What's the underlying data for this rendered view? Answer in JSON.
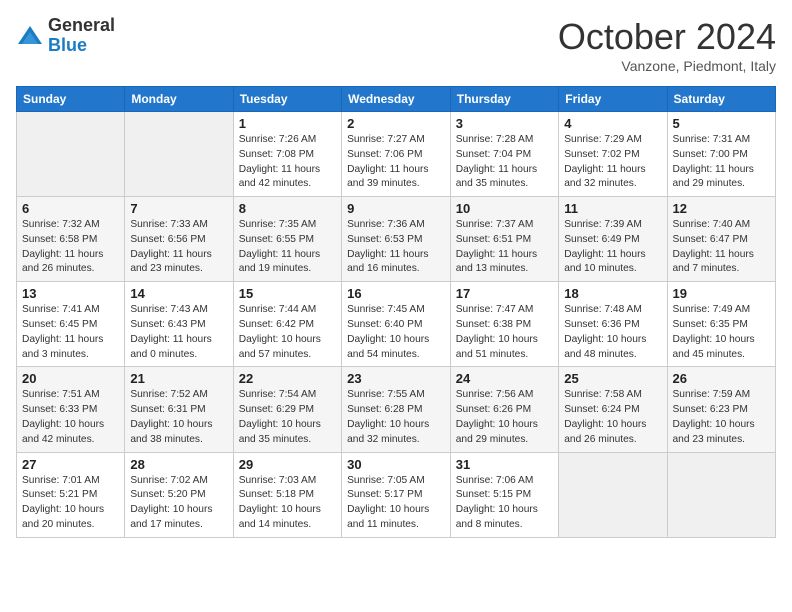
{
  "header": {
    "logo_line1": "General",
    "logo_line2": "Blue",
    "month": "October 2024",
    "location": "Vanzone, Piedmont, Italy"
  },
  "days_of_week": [
    "Sunday",
    "Monday",
    "Tuesday",
    "Wednesday",
    "Thursday",
    "Friday",
    "Saturday"
  ],
  "weeks": [
    [
      {
        "day": "",
        "info": ""
      },
      {
        "day": "",
        "info": ""
      },
      {
        "day": "1",
        "info": "Sunrise: 7:26 AM\nSunset: 7:08 PM\nDaylight: 11 hours and 42 minutes."
      },
      {
        "day": "2",
        "info": "Sunrise: 7:27 AM\nSunset: 7:06 PM\nDaylight: 11 hours and 39 minutes."
      },
      {
        "day": "3",
        "info": "Sunrise: 7:28 AM\nSunset: 7:04 PM\nDaylight: 11 hours and 35 minutes."
      },
      {
        "day": "4",
        "info": "Sunrise: 7:29 AM\nSunset: 7:02 PM\nDaylight: 11 hours and 32 minutes."
      },
      {
        "day": "5",
        "info": "Sunrise: 7:31 AM\nSunset: 7:00 PM\nDaylight: 11 hours and 29 minutes."
      }
    ],
    [
      {
        "day": "6",
        "info": "Sunrise: 7:32 AM\nSunset: 6:58 PM\nDaylight: 11 hours and 26 minutes."
      },
      {
        "day": "7",
        "info": "Sunrise: 7:33 AM\nSunset: 6:56 PM\nDaylight: 11 hours and 23 minutes."
      },
      {
        "day": "8",
        "info": "Sunrise: 7:35 AM\nSunset: 6:55 PM\nDaylight: 11 hours and 19 minutes."
      },
      {
        "day": "9",
        "info": "Sunrise: 7:36 AM\nSunset: 6:53 PM\nDaylight: 11 hours and 16 minutes."
      },
      {
        "day": "10",
        "info": "Sunrise: 7:37 AM\nSunset: 6:51 PM\nDaylight: 11 hours and 13 minutes."
      },
      {
        "day": "11",
        "info": "Sunrise: 7:39 AM\nSunset: 6:49 PM\nDaylight: 11 hours and 10 minutes."
      },
      {
        "day": "12",
        "info": "Sunrise: 7:40 AM\nSunset: 6:47 PM\nDaylight: 11 hours and 7 minutes."
      }
    ],
    [
      {
        "day": "13",
        "info": "Sunrise: 7:41 AM\nSunset: 6:45 PM\nDaylight: 11 hours and 3 minutes."
      },
      {
        "day": "14",
        "info": "Sunrise: 7:43 AM\nSunset: 6:43 PM\nDaylight: 11 hours and 0 minutes."
      },
      {
        "day": "15",
        "info": "Sunrise: 7:44 AM\nSunset: 6:42 PM\nDaylight: 10 hours and 57 minutes."
      },
      {
        "day": "16",
        "info": "Sunrise: 7:45 AM\nSunset: 6:40 PM\nDaylight: 10 hours and 54 minutes."
      },
      {
        "day": "17",
        "info": "Sunrise: 7:47 AM\nSunset: 6:38 PM\nDaylight: 10 hours and 51 minutes."
      },
      {
        "day": "18",
        "info": "Sunrise: 7:48 AM\nSunset: 6:36 PM\nDaylight: 10 hours and 48 minutes."
      },
      {
        "day": "19",
        "info": "Sunrise: 7:49 AM\nSunset: 6:35 PM\nDaylight: 10 hours and 45 minutes."
      }
    ],
    [
      {
        "day": "20",
        "info": "Sunrise: 7:51 AM\nSunset: 6:33 PM\nDaylight: 10 hours and 42 minutes."
      },
      {
        "day": "21",
        "info": "Sunrise: 7:52 AM\nSunset: 6:31 PM\nDaylight: 10 hours and 38 minutes."
      },
      {
        "day": "22",
        "info": "Sunrise: 7:54 AM\nSunset: 6:29 PM\nDaylight: 10 hours and 35 minutes."
      },
      {
        "day": "23",
        "info": "Sunrise: 7:55 AM\nSunset: 6:28 PM\nDaylight: 10 hours and 32 minutes."
      },
      {
        "day": "24",
        "info": "Sunrise: 7:56 AM\nSunset: 6:26 PM\nDaylight: 10 hours and 29 minutes."
      },
      {
        "day": "25",
        "info": "Sunrise: 7:58 AM\nSunset: 6:24 PM\nDaylight: 10 hours and 26 minutes."
      },
      {
        "day": "26",
        "info": "Sunrise: 7:59 AM\nSunset: 6:23 PM\nDaylight: 10 hours and 23 minutes."
      }
    ],
    [
      {
        "day": "27",
        "info": "Sunrise: 7:01 AM\nSunset: 5:21 PM\nDaylight: 10 hours and 20 minutes."
      },
      {
        "day": "28",
        "info": "Sunrise: 7:02 AM\nSunset: 5:20 PM\nDaylight: 10 hours and 17 minutes."
      },
      {
        "day": "29",
        "info": "Sunrise: 7:03 AM\nSunset: 5:18 PM\nDaylight: 10 hours and 14 minutes."
      },
      {
        "day": "30",
        "info": "Sunrise: 7:05 AM\nSunset: 5:17 PM\nDaylight: 10 hours and 11 minutes."
      },
      {
        "day": "31",
        "info": "Sunrise: 7:06 AM\nSunset: 5:15 PM\nDaylight: 10 hours and 8 minutes."
      },
      {
        "day": "",
        "info": ""
      },
      {
        "day": "",
        "info": ""
      }
    ]
  ]
}
